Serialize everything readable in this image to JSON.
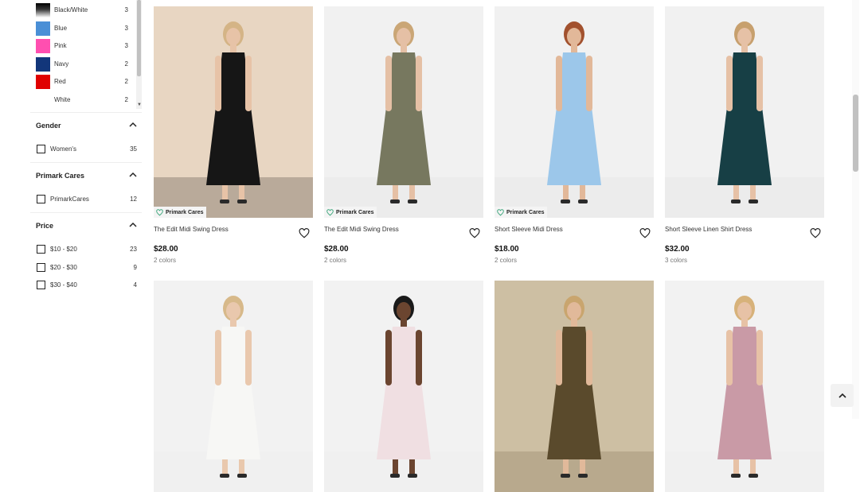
{
  "filters": {
    "colors": [
      {
        "label": "Black/White",
        "count": "3",
        "swatch": "linear-gradient(180deg,#000 0%,#3a3a3a 45%,#fff 100%)"
      },
      {
        "label": "Blue",
        "count": "3",
        "swatch": "#4a8fd6"
      },
      {
        "label": "Pink",
        "count": "3",
        "swatch": "#ff4fb0"
      },
      {
        "label": "Navy",
        "count": "2",
        "swatch": "#12367a"
      },
      {
        "label": "Red",
        "count": "2",
        "swatch": "#e00000"
      },
      {
        "label": "White",
        "count": "2",
        "swatch": "#ffffff"
      }
    ],
    "gender": {
      "title": "Gender",
      "options": [
        {
          "label": "Women's",
          "count": "35"
        }
      ]
    },
    "primark_cares": {
      "title": "Primark Cares",
      "options": [
        {
          "label": "PrimarkCares",
          "count": "12"
        }
      ]
    },
    "price": {
      "title": "Price",
      "options": [
        {
          "label": "$10 - $20",
          "count": "23"
        },
        {
          "label": "$20 - $30",
          "count": "9"
        },
        {
          "label": "$30 - $40",
          "count": "4"
        }
      ]
    }
  },
  "badge_text": "Primark Cares",
  "products": [
    {
      "name": "The Edit Midi Swing Dress",
      "price": "$28.00",
      "colors": "2 colors",
      "badge": true,
      "bg": "#e8d6c2",
      "floor": "#b9aa9a",
      "dress": "#161616",
      "skin": "#e7c3a7",
      "hair": "#d4b486"
    },
    {
      "name": "The Edit Midi Swing Dress",
      "price": "$28.00",
      "colors": "2 colors",
      "badge": true,
      "bg": "#f1f1f1",
      "floor": "#ececec",
      "dress": "#77785f",
      "skin": "#e5c0a5",
      "hair": "#caa676"
    },
    {
      "name": "Short Sleeve Midi Dress",
      "price": "$18.00",
      "colors": "2 colors",
      "badge": true,
      "bg": "#f1f1f1",
      "floor": "#ececec",
      "dress": "#9cc7ea",
      "skin": "#e2b899",
      "hair": "#a2512e"
    },
    {
      "name": "Short Sleeve Linen Shirt Dress",
      "price": "$32.00",
      "colors": "3 colors",
      "badge": false,
      "bg": "#f1f1f1",
      "floor": "#ececec",
      "dress": "#173f45",
      "skin": "#e6c1a6",
      "hair": "#c7a06e"
    },
    {
      "name": "",
      "price": "",
      "colors": "",
      "badge": false,
      "bg": "#f2f2f2",
      "floor": "#f0f0f0",
      "dress": "#f7f7f5",
      "skin": "#e9c8ad",
      "hair": "#d7b98a"
    },
    {
      "name": "",
      "price": "",
      "colors": "",
      "badge": false,
      "bg": "#f2f2f2",
      "floor": "#f0f0f0",
      "dress": "#f0dfe2",
      "skin": "#6b4530",
      "hair": "#1a1a1a"
    },
    {
      "name": "",
      "price": "",
      "colors": "",
      "badge": false,
      "bg": "#cdbfa3",
      "floor": "#b8a98d",
      "dress": "#5a4a2c",
      "skin": "#e1b99a",
      "hair": "#c9a56e"
    },
    {
      "name": "",
      "price": "",
      "colors": "",
      "badge": false,
      "bg": "#f2f2f2",
      "floor": "#f0f0f0",
      "dress": "#c99aa6",
      "skin": "#e7c2a6",
      "hair": "#d7b27a"
    }
  ]
}
